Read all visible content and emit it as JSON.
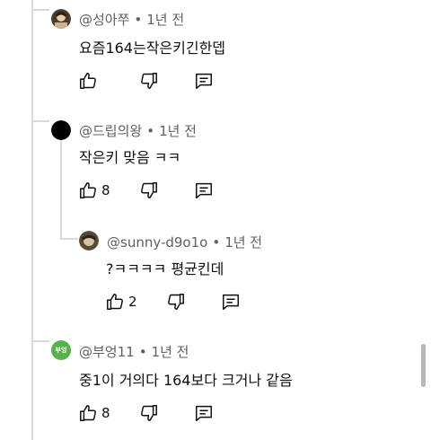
{
  "comments": [
    {
      "author": "@성아쭈",
      "time": "1년 전",
      "text": "요즘164는작은키긴한뎁",
      "likes": "",
      "avatar_icon": "avatar-photo-icon",
      "avatar_color": "#4a3b2a"
    },
    {
      "author": "@드립의왕",
      "time": "1년 전",
      "text": "작은키 맞음 ㅋㅋ",
      "likes": "8",
      "avatar_icon": "avatar-black-circle-icon",
      "avatar_color": "#000000"
    },
    {
      "author": "@sunny-d9o1o",
      "time": "1년 전",
      "text": "?ㅋㅋㅋㅋ 평균킨데",
      "likes": "2",
      "avatar_icon": "avatar-photo-icon",
      "avatar_color": "#5b4a38"
    },
    {
      "author": "@부엉11",
      "time": "1년 전",
      "text": "중1이 거의다 164보다 크거나 같음",
      "likes": "8",
      "avatar_text": "부엉",
      "avatar_icon": "avatar-text-icon",
      "avatar_color": "#56b04b"
    }
  ],
  "separator": "•",
  "icons": {
    "like": "thumbs-up-icon",
    "dislike": "thumbs-down-icon",
    "reply": "reply-icon"
  }
}
